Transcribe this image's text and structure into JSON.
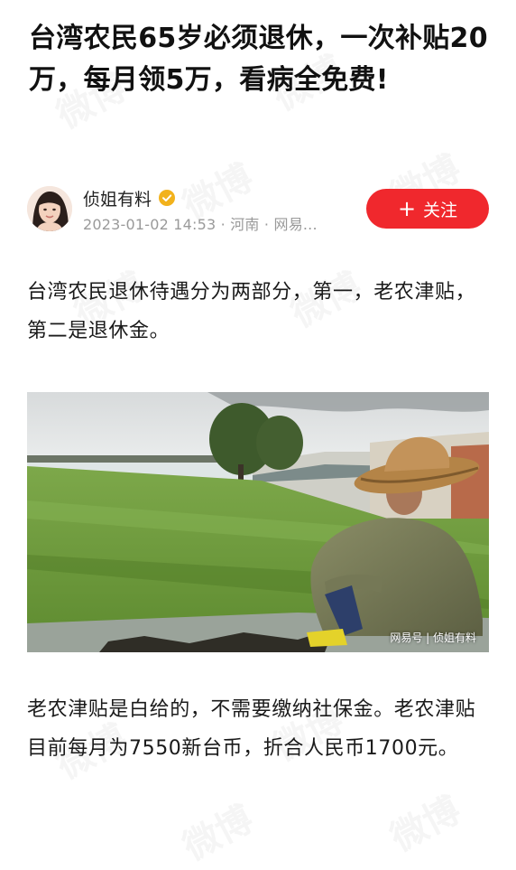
{
  "article": {
    "title": "台湾农民65岁必须退休，一次补贴20万，每月领5万，看病全免费!",
    "paragraph_1": "台湾农民退休待遇分为两部分，第一，老农津贴，第二是退休金。",
    "paragraph_2": "老农津贴是白给的，不需要缴纳社保金。老农津贴目前每月为7550新台币，折合人民币1700元。"
  },
  "author": {
    "name": "侦姐有料",
    "meta": "2023-01-02 14:53 · 河南 · 网易...",
    "verified_icon": "verified-badge-icon",
    "follow_label": "关注",
    "follow_icon": "plus-icon"
  },
  "photo": {
    "caption": "网易号 | 侦姐有料"
  },
  "colors": {
    "accent": "#f0282d",
    "verified": "#f2b21c",
    "meta_text": "#9a9a9a"
  }
}
